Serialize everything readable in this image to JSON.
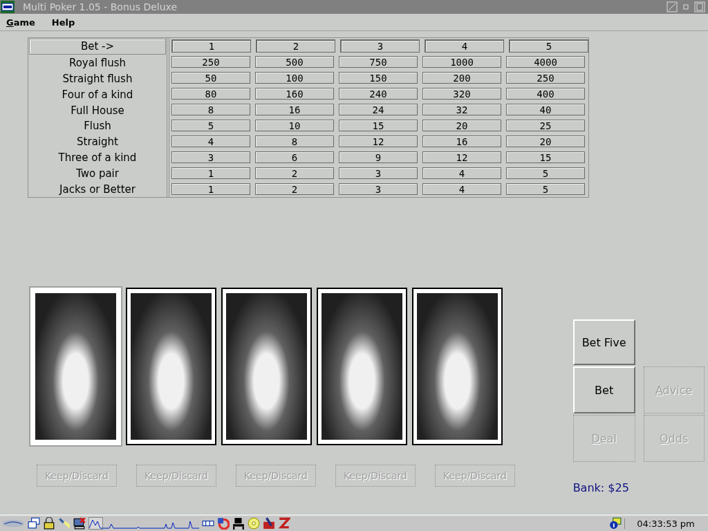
{
  "window": {
    "title": "Multi Poker 1.05 - Bonus Deluxe"
  },
  "menu": [
    {
      "label": "Game",
      "accelerator": true
    },
    {
      "label": "Help",
      "accelerator": false
    }
  ],
  "paytable": {
    "header": {
      "label": "Bet ->",
      "bets": [
        "1",
        "2",
        "3",
        "4",
        "5"
      ]
    },
    "rows": [
      {
        "hand": "Royal flush",
        "payouts": [
          "250",
          "500",
          "750",
          "1000",
          "4000"
        ]
      },
      {
        "hand": "Straight flush",
        "payouts": [
          "50",
          "100",
          "150",
          "200",
          "250"
        ]
      },
      {
        "hand": "Four of a kind",
        "payouts": [
          "80",
          "160",
          "240",
          "320",
          "400"
        ]
      },
      {
        "hand": "Full House",
        "payouts": [
          "8",
          "16",
          "24",
          "32",
          "40"
        ]
      },
      {
        "hand": "Flush",
        "payouts": [
          "5",
          "10",
          "15",
          "20",
          "25"
        ]
      },
      {
        "hand": "Straight",
        "payouts": [
          "4",
          "8",
          "12",
          "16",
          "20"
        ]
      },
      {
        "hand": "Three of a kind",
        "payouts": [
          "3",
          "6",
          "9",
          "12",
          "15"
        ]
      },
      {
        "hand": "Two pair",
        "payouts": [
          "1",
          "2",
          "3",
          "4",
          "5"
        ]
      },
      {
        "hand": "Jacks or Better",
        "payouts": [
          "1",
          "2",
          "3",
          "4",
          "5"
        ]
      }
    ]
  },
  "cards": [
    {
      "selected": true
    },
    {
      "selected": false
    },
    {
      "selected": false
    },
    {
      "selected": false
    },
    {
      "selected": false
    }
  ],
  "keep_buttons": [
    {
      "label": "Keep/Discard",
      "disabled": true
    },
    {
      "label": "Keep/Discard",
      "disabled": true
    },
    {
      "label": "Keep/Discard",
      "disabled": true
    },
    {
      "label": "Keep/Discard",
      "disabled": true
    },
    {
      "label": "Keep/Discard",
      "disabled": true
    }
  ],
  "buttons": [
    {
      "label": "Bet Five",
      "disabled": false,
      "accelerator": false
    },
    {
      "label": "Bet",
      "disabled": false,
      "accelerator": false
    },
    {
      "label": "Advice",
      "disabled": true,
      "accelerator": true
    },
    {
      "label": "Deal",
      "disabled": true,
      "accelerator": true
    },
    {
      "label": "Odds",
      "disabled": true,
      "accelerator": true
    }
  ],
  "bank": "Bank: $25",
  "taskbar": {
    "clock": "04:33:53 pm"
  }
}
